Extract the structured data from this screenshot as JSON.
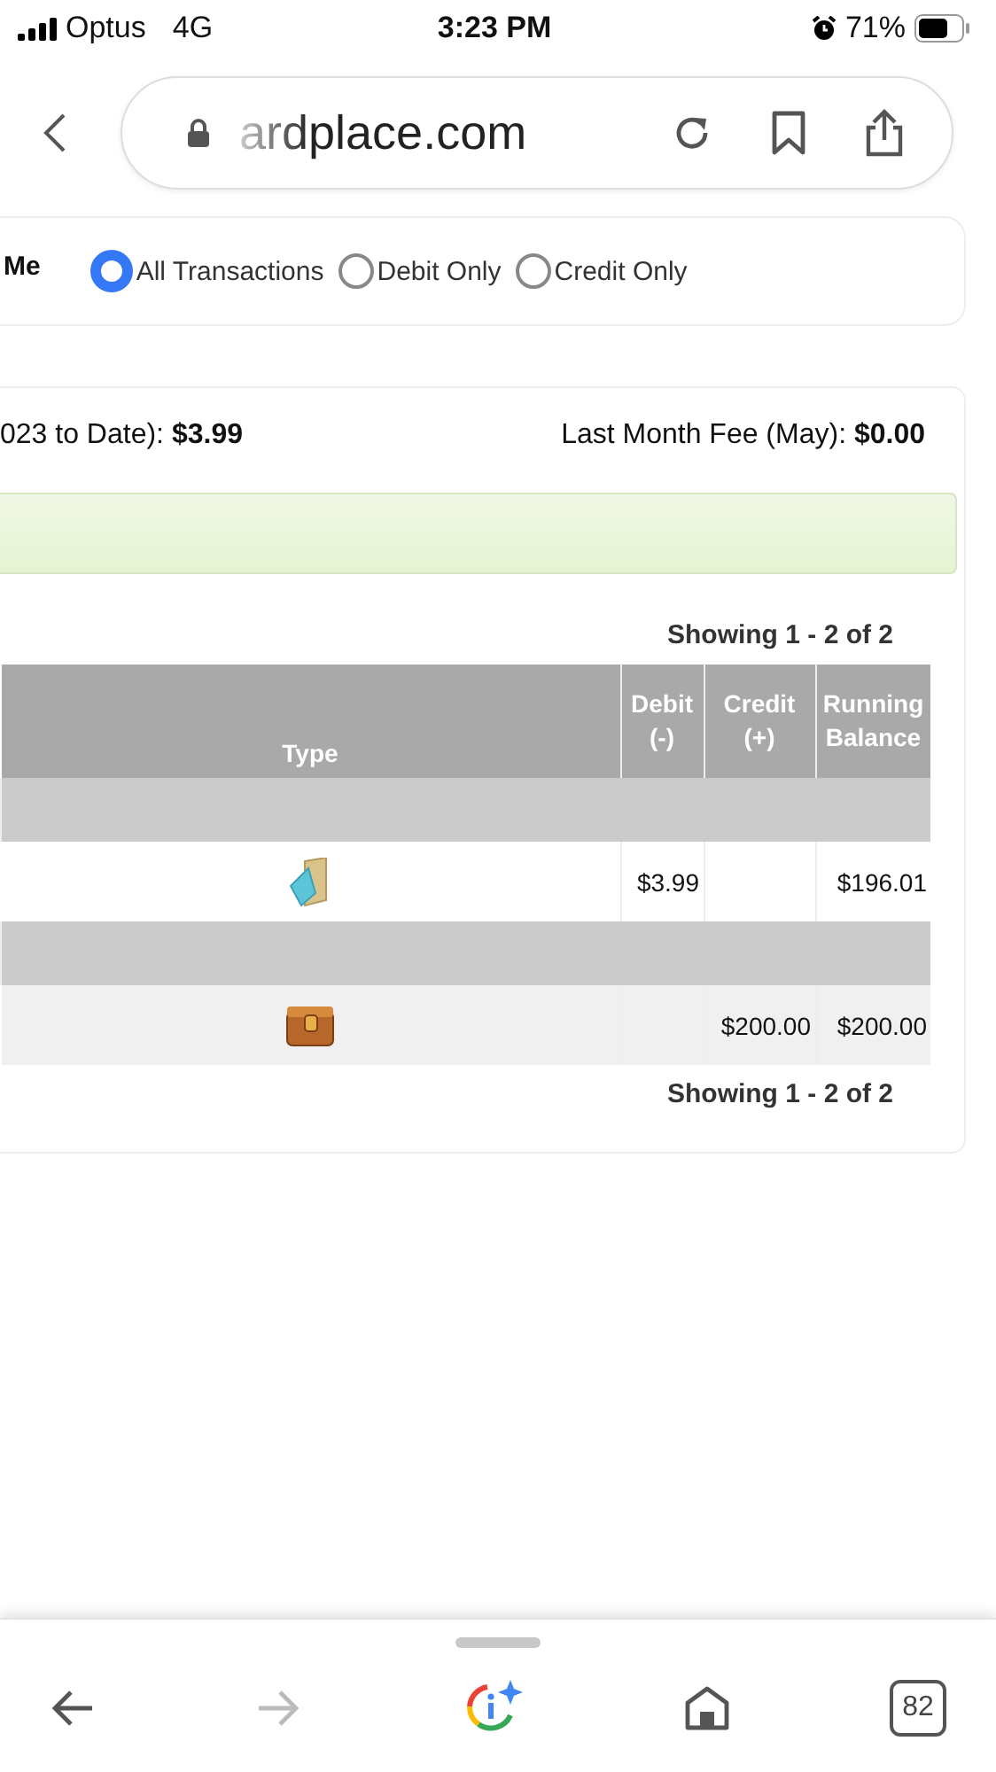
{
  "status_bar": {
    "carrier": "Optus",
    "network": "4G",
    "time": "3:23 PM",
    "battery": "71%"
  },
  "address_bar": {
    "url": "ardplace.com"
  },
  "filter": {
    "label": "Me",
    "options": [
      {
        "label": "All Transactions",
        "selected": true
      },
      {
        "label": "Debit Only",
        "selected": false
      },
      {
        "label": "Credit Only",
        "selected": false
      }
    ]
  },
  "fees": {
    "year_to_date": "023 to Date): **$3.99**",
    "last_month": "Last Month Fee (May): **$0.00**"
  },
  "table": {
    "pagination_top": "Showing 1 - 2 of 2",
    "pagination_bottom": "Showing 1 - 2 of 2",
    "columns": [
      "Type",
      "Debit (-)",
      "Credit (+)",
      "Running Balance"
    ],
    "rows": [
      {
        "kind": "group"
      },
      {
        "kind": "debit",
        "debit": "$3.99",
        "balance": "$196.01"
      },
      {
        "kind": "group"
      },
      {
        "kind": "credit",
        "credit": "$200.00",
        "balance": "$200.00"
      }
    ]
  },
  "toolbar": {
    "forward_disabled": true,
    "tab_count": "82"
  }
}
